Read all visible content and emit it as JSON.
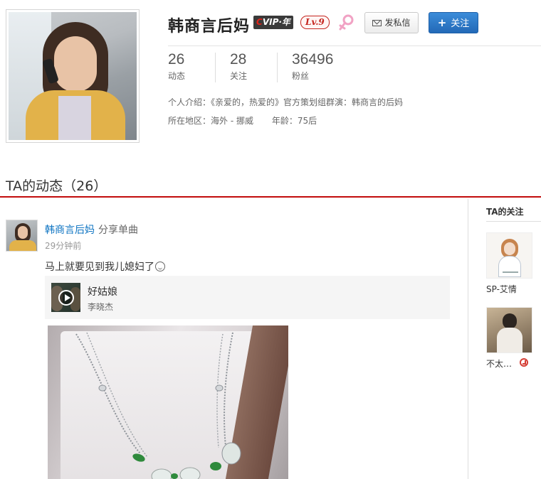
{
  "profile": {
    "name": "韩商言后妈",
    "vip_label": "VIP·年",
    "vip_prefix": "C",
    "level": "Lv.9",
    "gender_icon": "female-icon",
    "message_button": "发私信",
    "follow_button": "关注",
    "stats": [
      {
        "value": "26",
        "label": "动态"
      },
      {
        "value": "28",
        "label": "关注"
      },
      {
        "value": "36496",
        "label": "粉丝"
      }
    ],
    "intro_label": "个人介绍：",
    "intro_text": "《亲爱的，热爱的》官方策划组群演：韩商言的后妈",
    "location_label": "所在地区：",
    "location_value": "海外 - 挪威",
    "age_label": "年龄：",
    "age_value": "75后"
  },
  "feed": {
    "title": "TA的动态（26）",
    "post": {
      "user": "韩商言后妈",
      "action": "分享单曲",
      "time": "29分钟前",
      "text": "马上就要见到我儿媳妇了",
      "emoji": "smile-icon",
      "song_title": "好姑娘",
      "song_artist": "李晓杰"
    }
  },
  "sidebar": {
    "title": "TA的关注",
    "items": [
      {
        "name": "SP-艾情"
      },
      {
        "name": "不太…"
      }
    ]
  },
  "colors": {
    "accent_red": "#c20c0c",
    "link_blue": "#0c73c2",
    "follow_blue": "#2369b7"
  }
}
